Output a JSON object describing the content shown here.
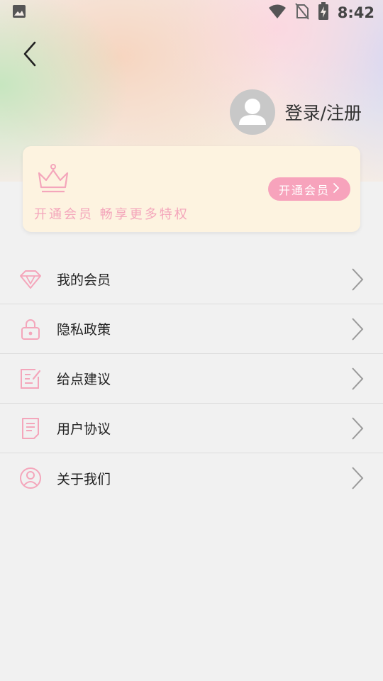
{
  "status_bar": {
    "time": "8:42",
    "icons": [
      "image-icon",
      "wifi-icon",
      "no-sim-icon",
      "battery-charging-icon"
    ]
  },
  "header": {
    "back_icon": "chevron-left-icon",
    "login_label": "登录/注册",
    "avatar_icon": "user-avatar-icon"
  },
  "vip_card": {
    "icon": "crown-icon",
    "slogan": "开通会员 畅享更多特权",
    "button_label": "开通会员"
  },
  "menu": [
    {
      "label": "我的会员",
      "icon": "diamond-icon"
    },
    {
      "label": "隐私政策",
      "icon": "lock-icon"
    },
    {
      "label": "给点建议",
      "icon": "edit-icon"
    },
    {
      "label": "用户协议",
      "icon": "document-icon"
    },
    {
      "label": "关于我们",
      "icon": "person-circle-icon"
    }
  ],
  "colors": {
    "accent_pink": "#f7a3bc",
    "card_bg": "#fdf3e0",
    "page_bg": "#f1f1f1",
    "arrow_gray": "#9a9a9a"
  }
}
